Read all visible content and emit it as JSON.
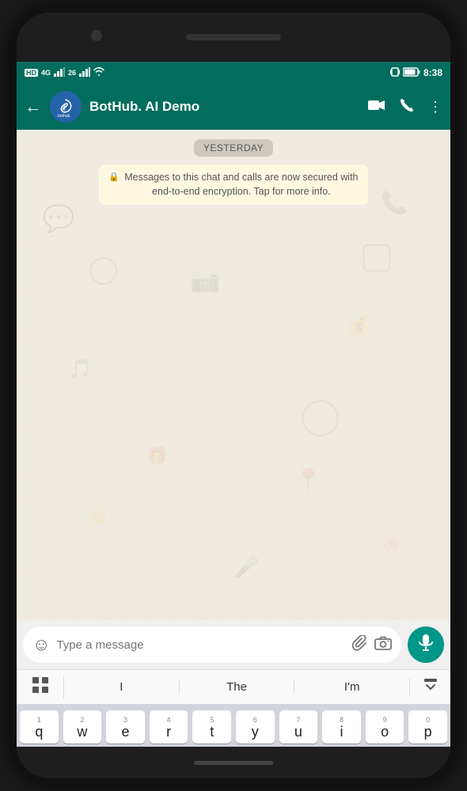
{
  "statusBar": {
    "left": "HD  46  26",
    "signals": "🔳📶📶",
    "wifi": "📶",
    "time": "8:38",
    "battery": "🔋"
  },
  "header": {
    "title": "BotHub. AI Demo",
    "back": "←",
    "videoIcon": "📹",
    "callIcon": "📞",
    "moreIcon": "⋮"
  },
  "chat": {
    "dateLabel": "YESTERDAY",
    "encryptionNotice": "Messages to this chat and calls are now secured with end-to-end encryption. Tap for more info.",
    "lockIcon": "🔒"
  },
  "inputBar": {
    "placeholder": "Type a message",
    "emojiIcon": "☺",
    "attachIcon": "📎",
    "cameraIcon": "📷",
    "micIcon": "🎤"
  },
  "autocomplete": {
    "words": [
      "I",
      "The",
      "I'm"
    ],
    "gridIcon": "⊞",
    "collapseIcon": "⬇"
  },
  "keyboard": {
    "rows": [
      [
        {
          "num": "1",
          "letter": "q"
        },
        {
          "num": "2",
          "letter": "w"
        },
        {
          "num": "3",
          "letter": "e"
        },
        {
          "num": "4",
          "letter": "r"
        },
        {
          "num": "5",
          "letter": "t"
        },
        {
          "num": "6",
          "letter": "y"
        },
        {
          "num": "7",
          "letter": "u"
        },
        {
          "num": "8",
          "letter": "i"
        },
        {
          "num": "9",
          "letter": "o"
        },
        {
          "num": "0",
          "letter": "p"
        }
      ]
    ]
  },
  "colors": {
    "teal": "#006d5e",
    "tealLight": "#009688",
    "chatBg": "#f0ebe0",
    "encryptionBg": "#fef8e1"
  }
}
